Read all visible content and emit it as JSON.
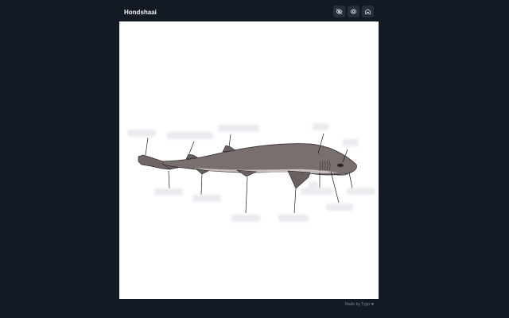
{
  "app": {
    "title": "Hondshaai"
  },
  "toolbar": {
    "buttons": [
      {
        "name": "eye-off-icon"
      },
      {
        "name": "eye-icon"
      },
      {
        "name": "home-icon"
      }
    ]
  },
  "diagram": {
    "labels": [
      {
        "id": "l1",
        "text": ""
      },
      {
        "id": "l2",
        "text": ""
      },
      {
        "id": "l3",
        "text": ""
      },
      {
        "id": "l4",
        "text": ""
      },
      {
        "id": "l5",
        "text": ""
      },
      {
        "id": "l6",
        "text": ""
      },
      {
        "id": "l7",
        "text": ""
      },
      {
        "id": "l8",
        "text": ""
      },
      {
        "id": "l9",
        "text": ""
      },
      {
        "id": "l10",
        "text": ""
      },
      {
        "id": "l11",
        "text": ""
      },
      {
        "id": "l12",
        "text": ""
      },
      {
        "id": "l13",
        "text": ""
      }
    ],
    "colors": {
      "body": "#7a6f6f",
      "belly": "#d9d4d2",
      "outline": "#2b2626"
    }
  },
  "footer": {
    "credit": "Made by Tygo"
  }
}
